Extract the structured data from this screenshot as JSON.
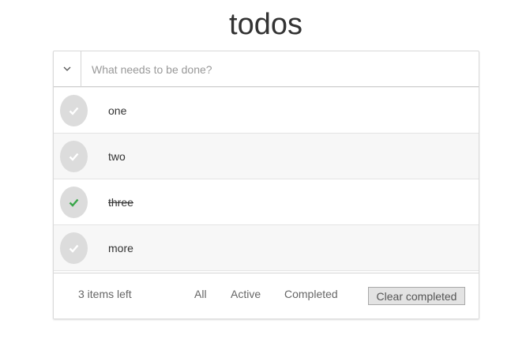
{
  "header": {
    "title": "todos"
  },
  "new_todo": {
    "placeholder": "What needs to be done?",
    "value": ""
  },
  "todos": [
    {
      "label": "one",
      "completed": false
    },
    {
      "label": "two",
      "completed": false
    },
    {
      "label": "three",
      "completed": true
    },
    {
      "label": "more",
      "completed": false
    }
  ],
  "footer": {
    "items_left": "3 items left",
    "filters": {
      "all": "All",
      "active": "Active",
      "completed": "Completed"
    },
    "clear_completed": "Clear completed"
  },
  "colors": {
    "check_done": "#3aa64a",
    "check_pending": "#ffffff",
    "check_circle": "#dcdcdc"
  },
  "icons": {
    "toggle_all": "chevron-down-icon",
    "todo_check": "checkmark-icon"
  }
}
